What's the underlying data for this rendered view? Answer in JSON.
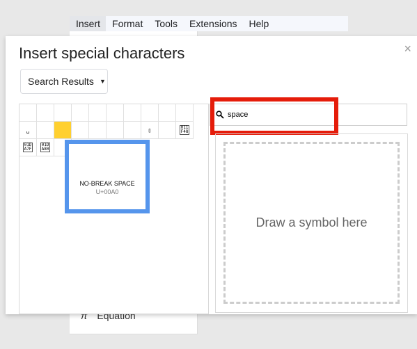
{
  "menu": [
    "Insert",
    "Format",
    "Tools",
    "Extensions",
    "Help"
  ],
  "dropdown": {
    "equation_label": "Equation",
    "equation_icon": "π"
  },
  "dialog": {
    "title": "Insert special characters",
    "close": "×",
    "category": "Search Results",
    "search": {
      "value": "space",
      "icon": "search-icon"
    },
    "draw_placeholder": "Draw a symbol here",
    "tooltip": {
      "name": "NO-BREAK SPACE",
      "code": "U+00A0"
    },
    "highlight_color": "#e51c0a",
    "selected_color": "#ffd02f",
    "cells": [
      [
        "",
        "",
        "",
        "",
        "",
        "",
        "",
        "",
        "",
        ""
      ],
      [
        "␣",
        "",
        "",
        "",
        "",
        "",
        "",
        "▯",
        "",
        "011\nF48"
      ],
      [
        "01D\nA7F",
        "01D\nA80",
        ""
      ]
    ]
  }
}
